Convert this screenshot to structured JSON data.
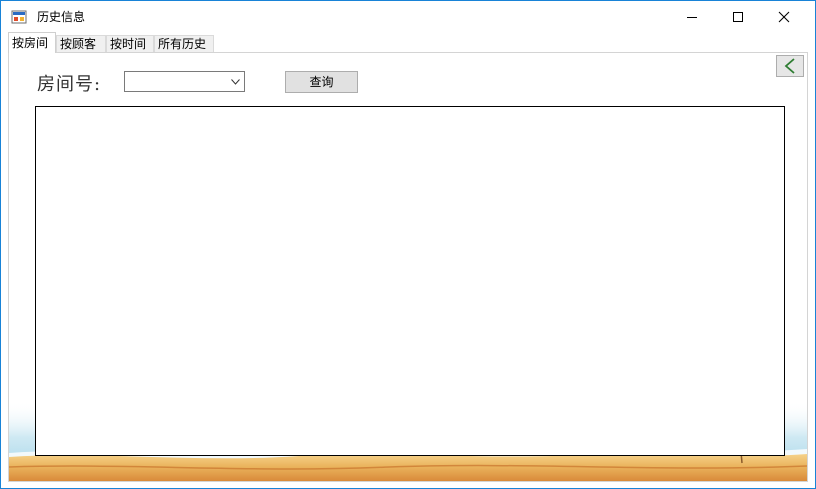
{
  "window": {
    "title": "历史信息",
    "controls": [
      "minimize",
      "maximize",
      "close"
    ]
  },
  "tabs": [
    {
      "label": "按房间",
      "active": true
    },
    {
      "label": "按顾客",
      "active": false
    },
    {
      "label": "按时间",
      "active": false
    },
    {
      "label": "所有历史",
      "active": false
    }
  ],
  "room_tab": {
    "room_label": "房间号:",
    "room_select": {
      "value": ""
    },
    "query_button": "查询",
    "back_button_icon": "chevron-left-icon",
    "back_button_color": "#2e7d32",
    "results": []
  },
  "colors": {
    "window_border": "#1883d7",
    "tab_active_bg": "#ffffff",
    "button_bg": "#e1e1e1"
  }
}
